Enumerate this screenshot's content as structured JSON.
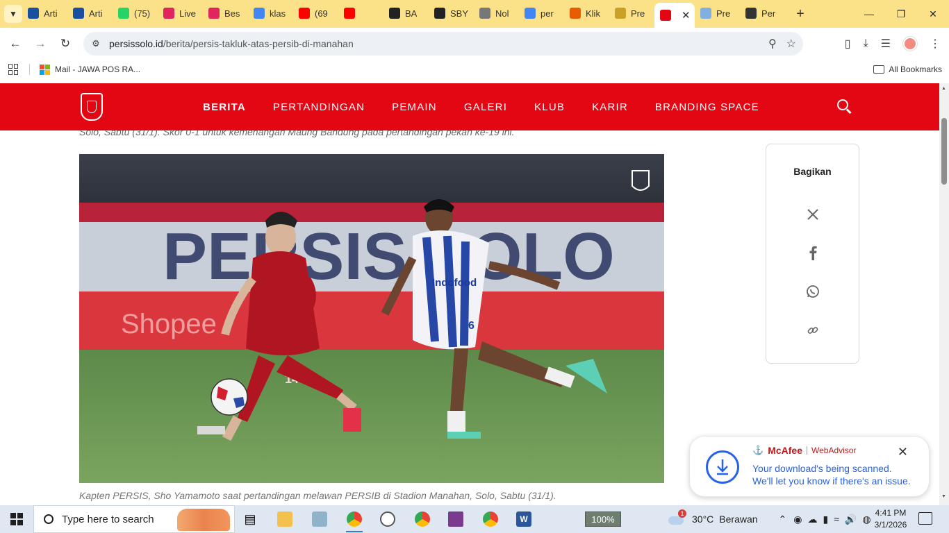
{
  "browser": {
    "tabs": [
      {
        "title": "Arti",
        "favicon": "ro-icon",
        "color": "#1a4fa0"
      },
      {
        "title": "Arti",
        "favicon": "ro-icon",
        "color": "#1a4fa0"
      },
      {
        "title": "(75)",
        "favicon": "whatsapp-icon",
        "color": "#25d366"
      },
      {
        "title": "Live",
        "favicon": "vidio-icon",
        "color": "#e0245e"
      },
      {
        "title": "Bes",
        "favicon": "vidio-icon",
        "color": "#e0245e"
      },
      {
        "title": "klas",
        "favicon": "google-icon",
        "color": "#4285f4"
      },
      {
        "title": "(69",
        "favicon": "youtube-icon",
        "color": "#ff0000"
      },
      {
        "title": "",
        "favicon": "youtube-icon",
        "color": "#ff0000"
      },
      {
        "title": "BA",
        "favicon": "app-icon",
        "color": "#222222"
      },
      {
        "title": "SBY",
        "favicon": "app-icon",
        "color": "#222222"
      },
      {
        "title": "Nol",
        "favicon": "globe-icon",
        "color": "#777777"
      },
      {
        "title": "per",
        "favicon": "google-icon",
        "color": "#4285f4"
      },
      {
        "title": "Klik",
        "favicon": "b-icon",
        "color": "#e65c00"
      },
      {
        "title": "Pre",
        "favicon": "coin-icon",
        "color": "#c8a02a"
      },
      {
        "title": "",
        "favicon": "persis-icon",
        "color": "#e30613"
      },
      {
        "title": "Pre",
        "favicon": "globe-icon",
        "color": "#7fb0e0"
      },
      {
        "title": "Per",
        "favicon": "wikipedia-icon",
        "color": "#333333"
      }
    ],
    "url_host": "persissolo.id",
    "url_path": "/berita/persis-takluk-atas-persib-di-manahan",
    "bookmarks": {
      "item_label": "Mail - JAWA POS RA...",
      "all_label": "All Bookmarks"
    }
  },
  "site": {
    "nav": [
      "BERITA",
      "PERTANDINGAN",
      "PEMAIN",
      "GALERI",
      "KLUB",
      "KARIR",
      "BRANDING SPACE"
    ],
    "brand_color": "#e30613"
  },
  "article": {
    "lead_text": "Solo, Sabtu (31/1). Skor 0-1 untuk kemenangan Maung Bandung pada pertandingan pekan ke-19 ini.",
    "caption": "Kapten PERSIS, Sho Yamamoto saat pertandingan melawan PERSIB di Stadion Manahan, Solo, Sabtu (31/1).",
    "banner_text": "PERSIS SOLO",
    "sponsor_text": "Shopee",
    "player_number_red": "14",
    "player_number_white": "6",
    "jersey_sponsor": "Indofood"
  },
  "share": {
    "title": "Bagikan",
    "buttons": [
      "x-icon",
      "facebook-icon",
      "whatsapp-icon",
      "link-icon"
    ]
  },
  "toast": {
    "brand": "McAfee",
    "product": "WebAdvisor",
    "line1": "Your download's being scanned.",
    "line2": "We'll let you know if there's an issue."
  },
  "taskbar": {
    "search_placeholder": "Type here to search",
    "zoom": "100%",
    "weather_temp": "30°C",
    "weather_desc": "Berawan",
    "weather_badge": "1",
    "time": "4:41 PM",
    "date": "3/1/2026"
  }
}
